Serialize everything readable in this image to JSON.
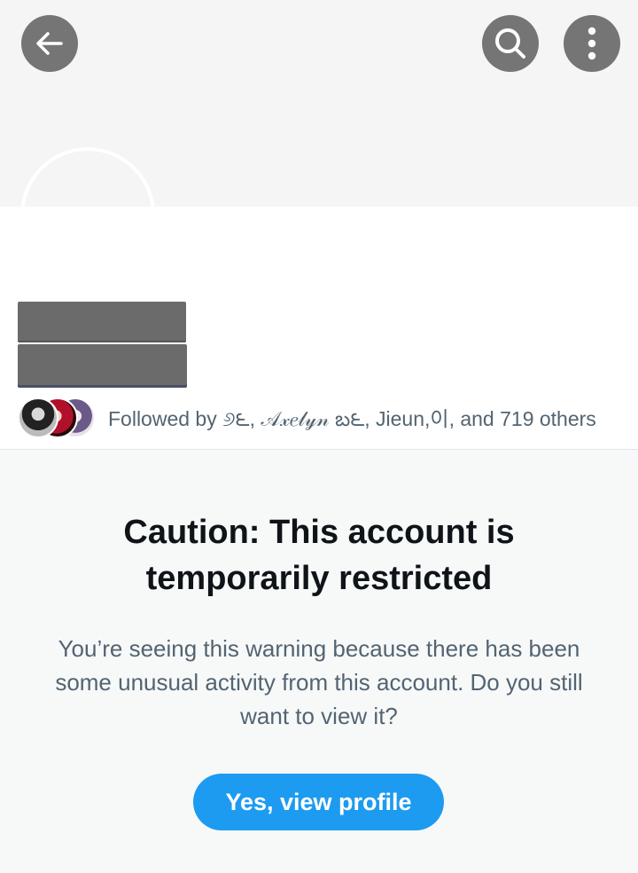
{
  "header": {
    "back_icon": "arrow-left-icon",
    "search_icon": "search-icon",
    "more_icon": "more-vertical-icon",
    "button_color": "#757575"
  },
  "profile": {
    "followed_by_text": "Followed by ୬౬, 𝒜𝓍𝑒𝓁𝓎𝓃 బ౬, Jieun,이, and 719 others"
  },
  "caution": {
    "title": "Caution: This account is temporarily restricted",
    "body": "You’re seeing this warning because there has been some unusual activity from this account. Do you still want to view it?",
    "button_label": "Yes, view profile",
    "button_color": "#1d9bf0"
  }
}
